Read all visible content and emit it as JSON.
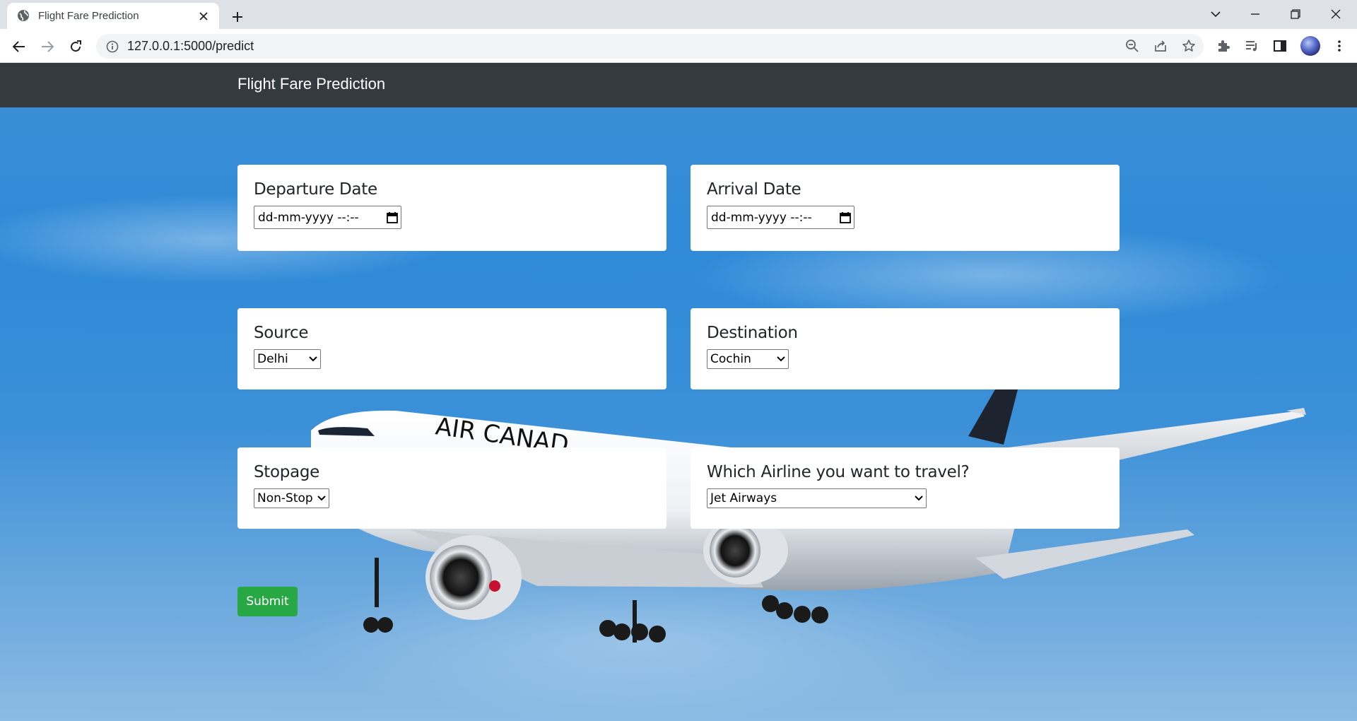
{
  "browser": {
    "tab_title": "Flight Fare Prediction",
    "url": "127.0.0.1:5000/predict"
  },
  "navbar": {
    "brand": "Flight Fare Prediction"
  },
  "form": {
    "departure": {
      "label": "Departure Date",
      "value": "dd-mm-yyyy --:--"
    },
    "arrival": {
      "label": "Arrival Date",
      "value": "dd-mm-yyyy --:--"
    },
    "source": {
      "label": "Source",
      "selected": "Delhi"
    },
    "destination": {
      "label": "Destination",
      "selected": "Cochin"
    },
    "stopage": {
      "label": "Stopage",
      "selected": "Non-Stop"
    },
    "airline": {
      "label": "Which Airline you want to travel?",
      "selected": "Jet Airways"
    },
    "submit_label": "Submit"
  },
  "background": {
    "aircraft_livery": "AIR CANAD"
  },
  "colors": {
    "navbar": "#343a40",
    "submit": "#28a745",
    "sky": "#2f8ad8"
  }
}
